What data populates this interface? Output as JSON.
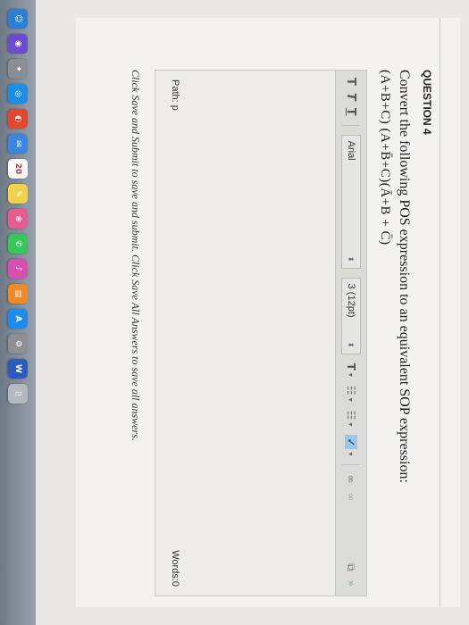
{
  "question": {
    "title": "QUESTION 4",
    "text": "Convert the following POS expression to an equivalent SOP expression:",
    "expression": "(A+B+C) (A+B̄+C)(Ā+B + C̄)"
  },
  "editor": {
    "toolbar": {
      "bold": "T",
      "italic": "T",
      "underline": "T",
      "font_family": "Arial",
      "font_size": "3 (12pt)",
      "text_color": "T",
      "bullet_list": "☷",
      "numbered_list": "☷",
      "spellcheck": "✓",
      "link": "∞",
      "unlink": "∞",
      "paste": "⧉",
      "more": "»"
    },
    "path_label": "Path: p",
    "words_label": "Words:0"
  },
  "footer_text": "Click Save and Submit to save and submit. Click Save All Answers to save all answers.",
  "dock": {
    "icons": [
      {
        "name": "finder-icon",
        "glyph": "☺",
        "color": "#2b7fd6"
      },
      {
        "name": "siri-icon",
        "glyph": "◉",
        "color": "#6c4bd1"
      },
      {
        "name": "launchpad-icon",
        "glyph": "✦",
        "color": "#8a8f96"
      },
      {
        "name": "safari-icon",
        "glyph": "◎",
        "color": "#1a8ee8"
      },
      {
        "name": "chrome-icon",
        "glyph": "◐",
        "color": "#e0492e"
      },
      {
        "name": "mail-icon",
        "glyph": "✉",
        "color": "#3a86e0"
      },
      {
        "name": "calendar-icon",
        "glyph": "20",
        "color": "#ffffff"
      },
      {
        "name": "notes-icon",
        "glyph": "✎",
        "color": "#f2d14a"
      },
      {
        "name": "photos-icon",
        "glyph": "❀",
        "color": "#e85d8f"
      },
      {
        "name": "messages-icon",
        "glyph": "✆",
        "color": "#34c759"
      },
      {
        "name": "itunes-icon",
        "glyph": "♪",
        "color": "#d94fb0"
      },
      {
        "name": "ibooks-icon",
        "glyph": "▤",
        "color": "#f08a24"
      },
      {
        "name": "appstore-icon",
        "glyph": "A",
        "color": "#1c8cf0"
      },
      {
        "name": "preferences-icon",
        "glyph": "⚙",
        "color": "#8d8f93"
      },
      {
        "name": "word-icon",
        "glyph": "W",
        "color": "#2b5bbd"
      },
      {
        "name": "trash-icon",
        "glyph": "▯",
        "color": "#b5bac0"
      }
    ]
  }
}
